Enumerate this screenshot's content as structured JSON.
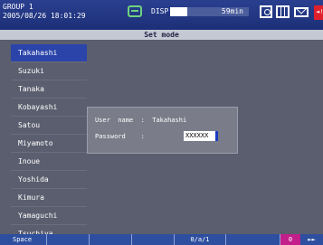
{
  "header": {
    "group_line": "GROUP 1",
    "datetime": "2005/08/26 18:01:29",
    "disp_label": "DISP",
    "bar_level": 0.22,
    "bar_text": "59min"
  },
  "mode_title": "Set mode",
  "users": [
    "Takahashi",
    "Suzuki",
    "Tanaka",
    "Kobayashi",
    "Satou",
    "Miyamoto",
    "Inoue",
    "Yoshida",
    "Kimura",
    "Yamaguchi",
    "Tsuchiya"
  ],
  "selected_index": 0,
  "login": {
    "user_label": "User  name  :",
    "user_value": "Takahashi",
    "password_label": "Password    :",
    "password_value": "XXXXXX"
  },
  "softkeys": {
    "k1": "Space",
    "k5": "0/a/1",
    "page": "0",
    "page2": "►►"
  },
  "alarm_text": "◄!"
}
